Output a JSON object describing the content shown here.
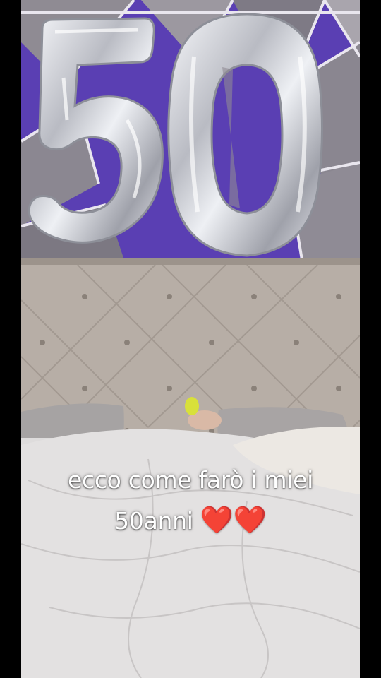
{
  "caption": {
    "line1": "ecco come farò i miei",
    "line2_text": "50anni",
    "line2_emoji": "❤️❤️"
  },
  "scene": {
    "balloon_digits": [
      "5",
      "0"
    ],
    "colors": {
      "wall_purple": "#5a3fb3",
      "wall_grey": "#8f8b93",
      "balloon_silver": "#d9dadf",
      "headboard": "#b7aea6",
      "duvet": "#dedcdc",
      "frame": "#000000"
    }
  }
}
